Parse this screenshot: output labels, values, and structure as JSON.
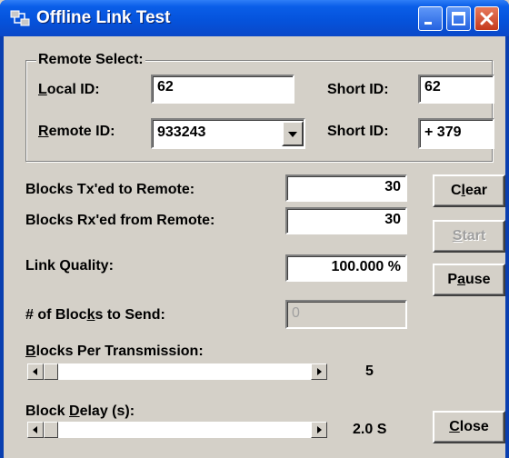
{
  "window": {
    "title": "Offline Link Test",
    "icons": {
      "app": "link-test-icon",
      "minimize": "minimize-icon",
      "maximize": "maximize-icon",
      "close": "close-icon"
    }
  },
  "remote_select": {
    "legend": "Remote Select:",
    "local_id_label_u": "L",
    "local_id_label_rest": "ocal ID:",
    "local_id_value": "62",
    "local_short_id_label": "Short ID:",
    "local_short_id_value": "62",
    "remote_id_label_u": "R",
    "remote_id_label_rest": "emote ID:",
    "remote_id_value": "933243",
    "remote_short_id_label": "Short ID:",
    "remote_short_id_value": "+ 379"
  },
  "stats": {
    "tx_label": "Blocks Tx'ed to Remote:",
    "tx_value": "30",
    "rx_label": "Blocks Rx'ed from Remote:",
    "rx_value": "30",
    "quality_label": "Link Quality:",
    "quality_value": "100.000 %",
    "send_label_pre": "# of Bloc",
    "send_label_u": "k",
    "send_label_post": "s to Send:",
    "send_placeholder": "0"
  },
  "sliders": {
    "bpt_label_u": "B",
    "bpt_label_rest": "locks Per Transmission:",
    "bpt_value": "5",
    "bpt_position": 0.0,
    "delay_label_pre": "Block ",
    "delay_label_u": "D",
    "delay_label_post": "elay (s):",
    "delay_value": "2.0 S",
    "delay_position": 0.0
  },
  "buttons": {
    "clear_pre": "C",
    "clear_u": "l",
    "clear_post": "ear",
    "start_u": "S",
    "start_post": "tart",
    "pause_pre": "P",
    "pause_u": "a",
    "pause_post": "use",
    "close_u": "C",
    "close_post": "lose"
  }
}
